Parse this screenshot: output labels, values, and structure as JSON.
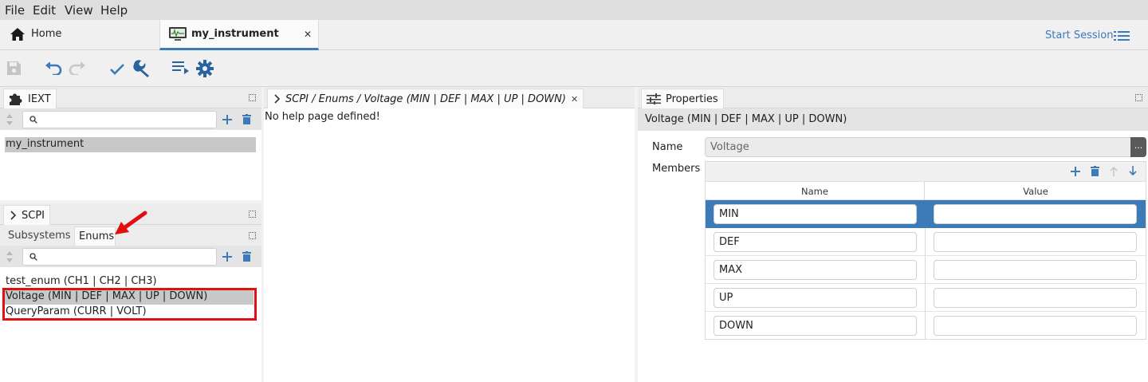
{
  "menu": [
    "File",
    "Edit",
    "View",
    "Help"
  ],
  "tabs": {
    "home_label": "Home",
    "instrument_label": "my_instrument",
    "close_glyph": "✕",
    "start_session": "Start Session"
  },
  "iext_panel": {
    "title": "IEXT",
    "items": [
      "my_instrument"
    ]
  },
  "scpi_panel": {
    "title": "SCPI",
    "subtabs": [
      "Subsystems",
      "Enums"
    ],
    "items": [
      "test_enum (CH1 | CH2 | CH3)",
      "Voltage (MIN | DEF | MAX | UP | DOWN)",
      "QueryParam (CURR | VOLT)"
    ]
  },
  "help_panel": {
    "breadcrumb": "SCPI / Enums / Voltage (MIN | DEF | MAX | UP | DOWN)",
    "content": "No help page defined!"
  },
  "properties_panel": {
    "title": "Properties",
    "subtitle": "Voltage (MIN | DEF | MAX | UP | DOWN)",
    "name_label": "Name",
    "name_value": "Voltage",
    "browse_glyph": "...",
    "members_label": "Members",
    "columns": [
      "Name",
      "Value"
    ],
    "rows": [
      {
        "name": "MIN",
        "value": ""
      },
      {
        "name": "DEF",
        "value": ""
      },
      {
        "name": "MAX",
        "value": ""
      },
      {
        "name": "UP",
        "value": ""
      },
      {
        "name": "DOWN",
        "value": ""
      }
    ]
  },
  "colors": {
    "accent": "#3d7ab8",
    "selection": "#c8c8c8",
    "annotation": "#e01010"
  }
}
